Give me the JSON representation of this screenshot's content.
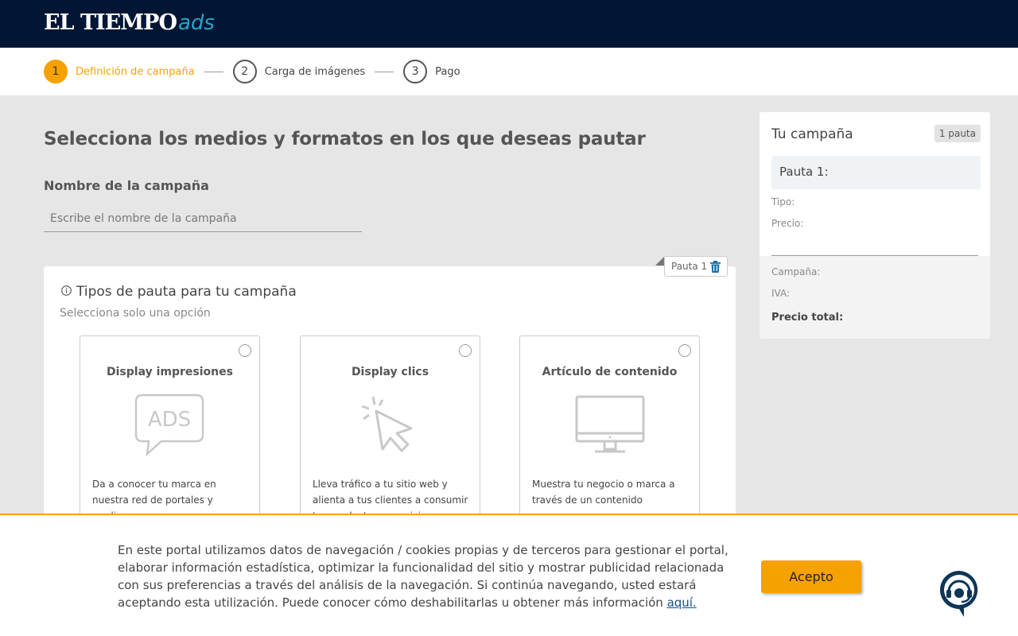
{
  "header": {
    "logo_main": "EL TIEMPO",
    "logo_ads": "ads"
  },
  "stepper": {
    "steps": [
      {
        "number": "1",
        "label": "Definición de campaña"
      },
      {
        "number": "2",
        "label": "Carga de imágenes"
      },
      {
        "number": "3",
        "label": "Pago"
      }
    ]
  },
  "main": {
    "heading": "Selecciona los medios y formatos en los que deseas pautar",
    "name_label": "Nombre de la campaña",
    "name_placeholder": "Escribe el nombre de la campaña",
    "pauta_tag": "Pauta 1",
    "types_title": "Tipos de pauta para tu campaña",
    "types_subtitle": "Selecciona solo una opción",
    "options": [
      {
        "title": "Display impresiones",
        "icon": "ads-bubble-icon",
        "description": "Da a conocer tu marca en nuestra red de portales y medios"
      },
      {
        "title": "Display clics",
        "icon": "cursor-click-icon",
        "description": "Lleva tráfico a tu sitio web y alienta a tus clientes a consumir tus productos o servicios"
      },
      {
        "title": "Artículo de contenido",
        "icon": "monitor-icon",
        "description": "Muestra tu negocio o marca a través de un contenido"
      }
    ]
  },
  "summary": {
    "title": "Tu campaña",
    "badge": "1 pauta",
    "pauta_label": "Pauta 1:",
    "tipo_label": "Tipo:",
    "precio_label": "Precio:",
    "campana_label": "Campaña:",
    "iva_label": "IVA:",
    "total_label": "Precio total:"
  },
  "cookie": {
    "text": "En este portal utilizamos datos de navegación / cookies propias y de terceros para gestionar el portal, elaborar información estadística, optimizar la funcionalidad del sitio y mostrar publicidad relacionada con sus preferencias a través del análisis de la navegación. Si continúa navegando, usted estará aceptando esta utilización. Puede conocer cómo deshabilitarlas u obtener más información",
    "link": "aquí.",
    "accept": "Acepto"
  },
  "colors": {
    "navy": "#011634",
    "accent": "#f5a100",
    "teal": "#2aa4c9"
  }
}
